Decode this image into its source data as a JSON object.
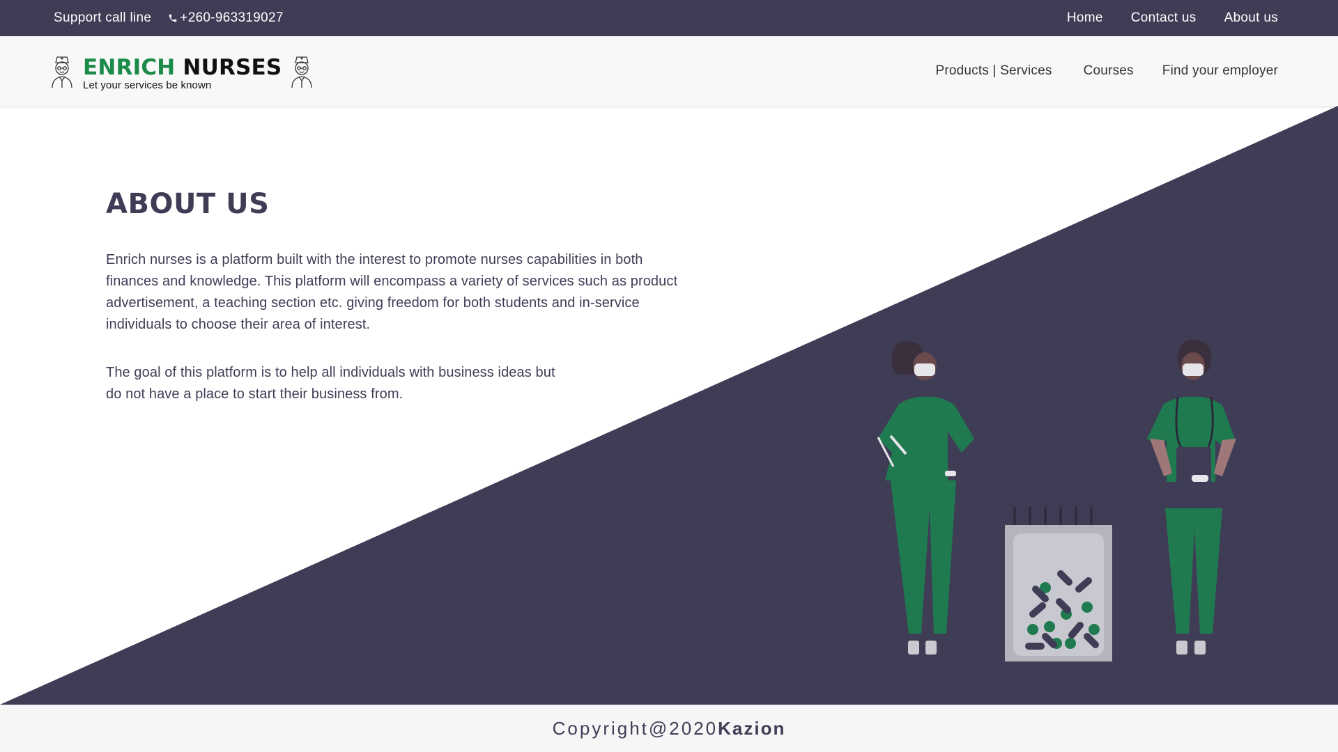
{
  "topbar": {
    "support_label": "Support call line",
    "phone": "+260-963319027",
    "links": [
      "Home",
      "Contact us",
      "About us"
    ]
  },
  "header": {
    "brand_part1": "ENRICH",
    "brand_part2": "NURSES",
    "tagline": "Let your services be known",
    "nav": [
      "Products | Services",
      "Courses",
      "Find your employer"
    ]
  },
  "about": {
    "title": "ABOUT US",
    "paragraph1": "Enrich nurses is a platform built with the interest to promote nurses capabilities in both finances and knowledge. This platform will encompass a variety of services such as product advertisement, a teaching section etc. giving freedom for both students and in-service individuals to choose their area of interest.",
    "paragraph2": "The goal of this platform is to help all individuals with business ideas but do not have a place to start their business from."
  },
  "footer": {
    "copyright": "Copyright@2020",
    "company": "Kazion"
  },
  "colors": {
    "primary_dark": "#3f3d56",
    "brand_green": "#1a8b48",
    "scrub_green": "#1f7a4f",
    "header_bg": "#f8f8f8"
  },
  "icons": [
    "phone-icon",
    "nurse-icon",
    "nurse-icon"
  ]
}
